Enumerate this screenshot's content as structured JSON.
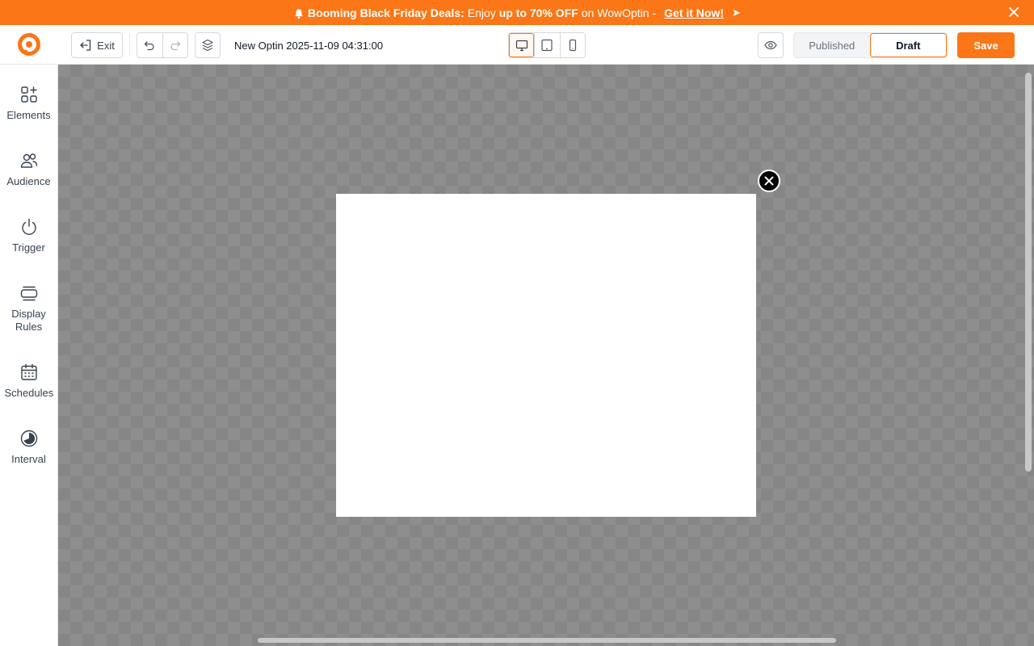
{
  "promo": {
    "bold_lead": "Booming Black Friday Deals:",
    "text1": "Enjoy",
    "discount": "up to 70% OFF",
    "text2": "on WowOptin -",
    "cta": "Get it Now!",
    "arrow": "➤",
    "icon": "bell-icon",
    "bg_color": "#fb7617"
  },
  "toolbar": {
    "exit_label": "Exit",
    "optin_title": "New Optin 2025-11-09 04:31:00",
    "devices": [
      "desktop",
      "tablet",
      "mobile"
    ],
    "active_device": "desktop",
    "status_options": [
      "Published",
      "Draft"
    ],
    "active_status": "Draft",
    "save_label": "Save",
    "accent_color": "#fb7617"
  },
  "sidebar": {
    "items": [
      {
        "label": "Elements",
        "icon": "elements-icon"
      },
      {
        "label": "Audience",
        "icon": "audience-icon"
      },
      {
        "label": "Trigger",
        "icon": "power-icon"
      },
      {
        "label": "Display Rules",
        "icon": "display-rules-icon"
      },
      {
        "label": "Schedules",
        "icon": "calendar-icon"
      },
      {
        "label": "Interval",
        "icon": "interval-icon"
      }
    ]
  }
}
